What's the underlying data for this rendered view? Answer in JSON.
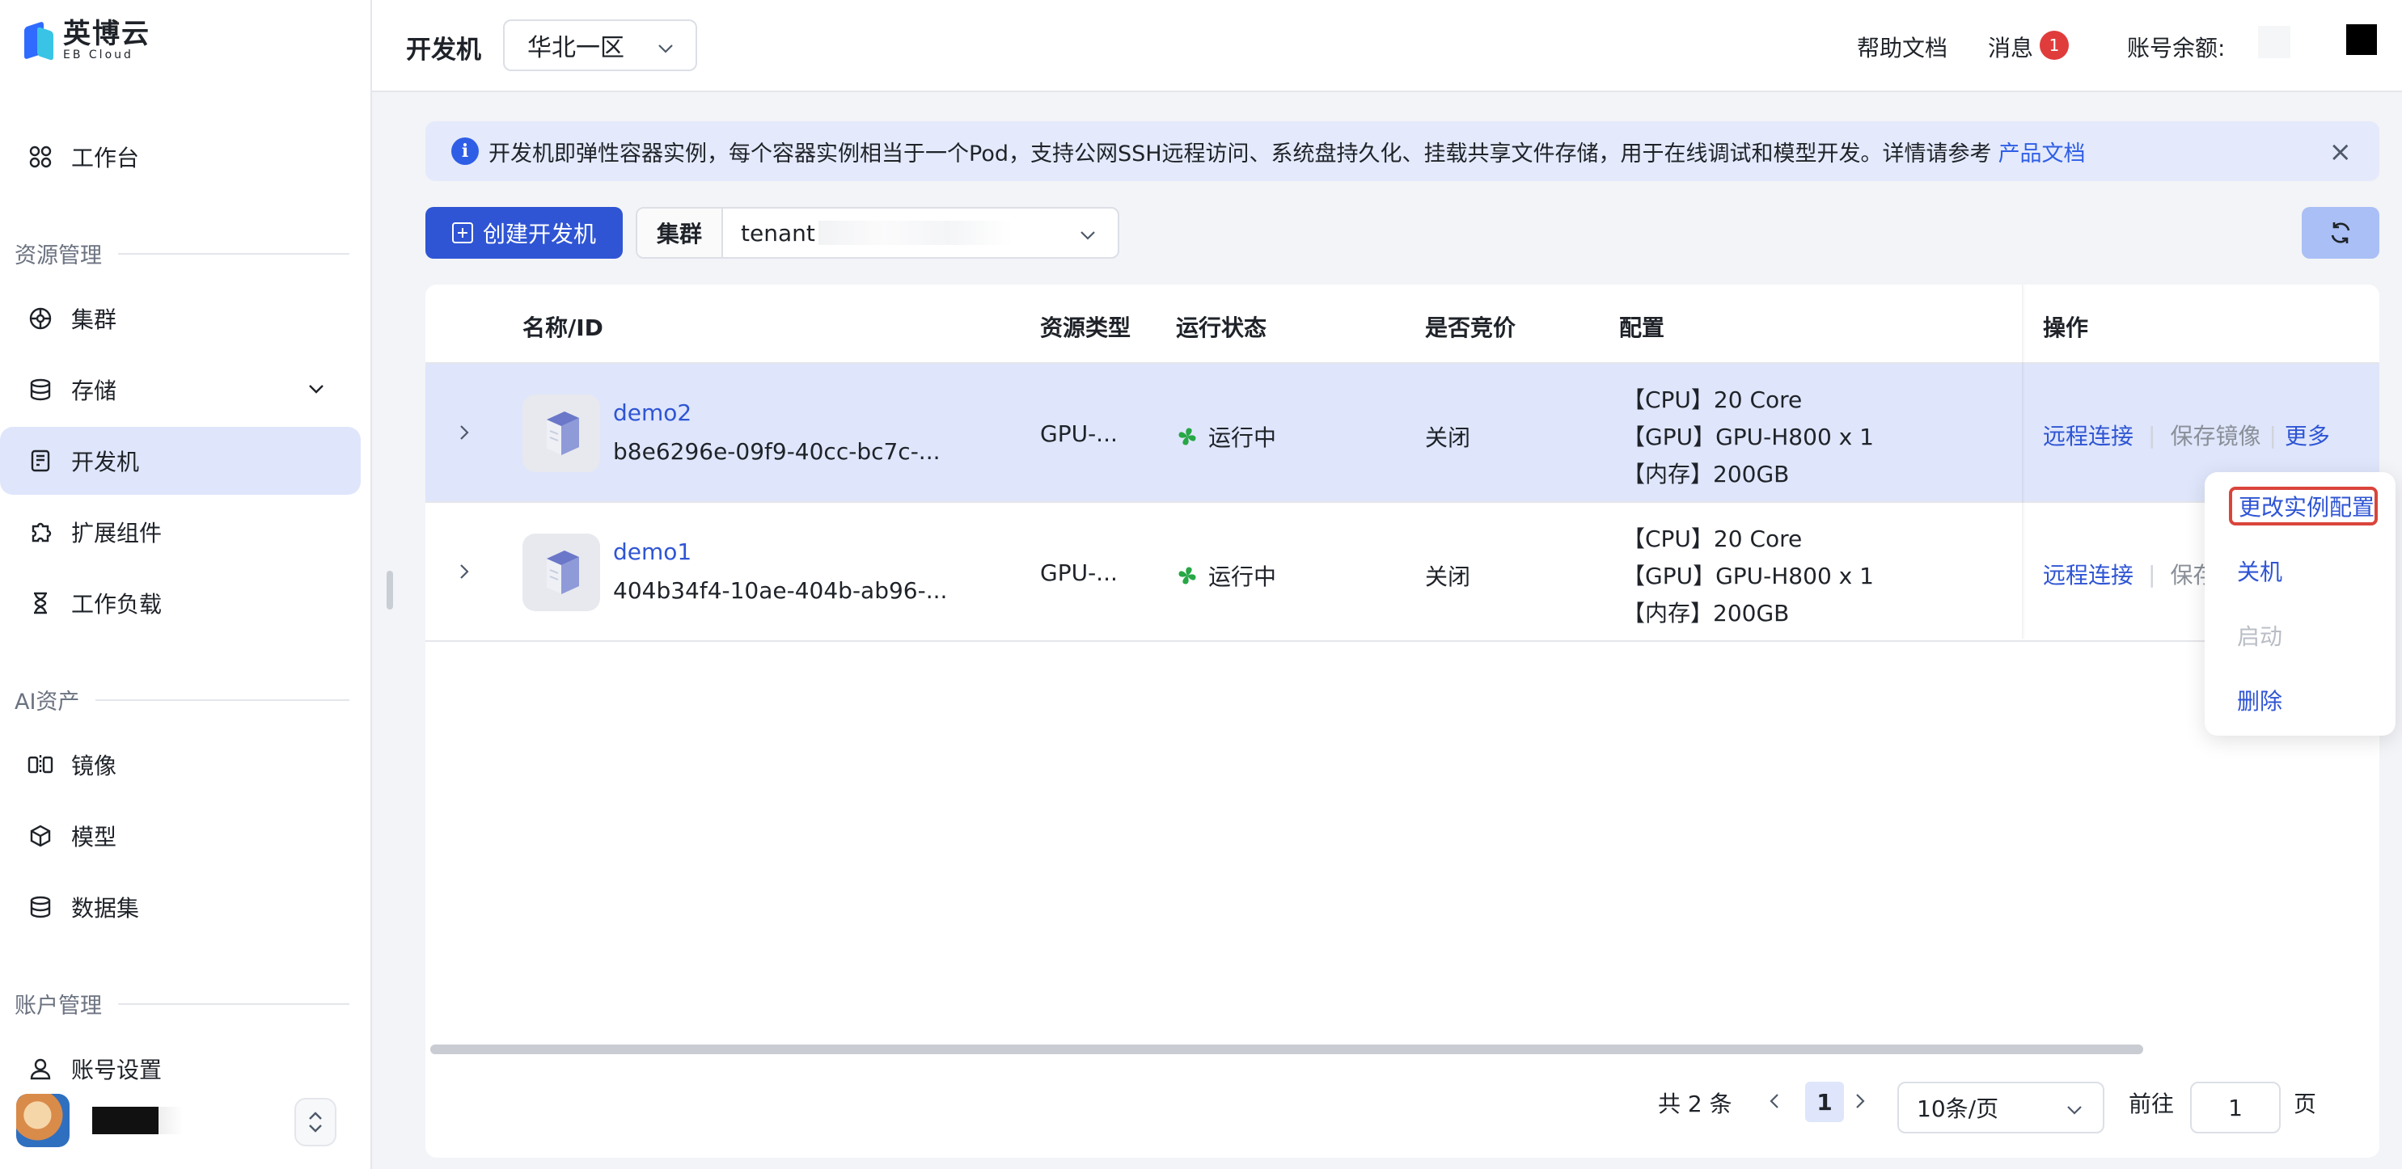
{
  "brand": {
    "name_cn": "英博云",
    "name_en": "EB Cloud"
  },
  "sidebar": {
    "items_top": [
      {
        "label": "工作台",
        "icon": "grid-icon"
      }
    ],
    "sections": [
      {
        "title": "资源管理",
        "items": [
          {
            "label": "集群",
            "icon": "cluster-icon"
          },
          {
            "label": "存储",
            "icon": "database-icon",
            "expandable": true
          },
          {
            "label": "开发机",
            "icon": "devbox-icon",
            "active": true
          },
          {
            "label": "扩展组件",
            "icon": "puzzle-icon"
          },
          {
            "label": "工作负载",
            "icon": "hourglass-icon"
          }
        ]
      },
      {
        "title": "AI资产",
        "items": [
          {
            "label": "镜像",
            "icon": "mirror-icon"
          },
          {
            "label": "模型",
            "icon": "cube-icon"
          },
          {
            "label": "数据集",
            "icon": "dataset-icon"
          }
        ]
      },
      {
        "title": "账户管理",
        "items": [
          {
            "label": "账号设置",
            "icon": "user-icon"
          }
        ]
      }
    ]
  },
  "header": {
    "title": "开发机",
    "region": "华北一区",
    "help": "帮助文档",
    "messages": "消息",
    "message_count": "1",
    "balance_label": "账号余额:"
  },
  "banner": {
    "text": "开发机即弹性容器实例，每个容器实例相当于一个Pod，支持公网SSH远程访问、系统盘持久化、挂载共享文件存储，用于在线调试和模型开发。详情请参考",
    "link": "产品文档",
    "close": "×"
  },
  "toolbar": {
    "create_label": "创建开发机",
    "cluster_label": "集群",
    "cluster_value": "tenant"
  },
  "table": {
    "columns": [
      "名称/ID",
      "资源类型",
      "运行状态",
      "是否竞价",
      "配置",
      "操作"
    ],
    "rows": [
      {
        "name": "demo2",
        "id": "b8e6296e-09f9-40cc-bc7c-...",
        "resource_type": "GPU-...",
        "status": "运行中",
        "spot": "关闭",
        "config": [
          "【CPU】20 Core",
          "【GPU】GPU-H800 x 1",
          "【内存】200GB"
        ],
        "ops": [
          "远程连接",
          "保存镜像",
          "更多"
        ]
      },
      {
        "name": "demo1",
        "id": "404b34f4-10ae-404b-ab96-...",
        "resource_type": "GPU-...",
        "status": "运行中",
        "spot": "关闭",
        "config": [
          "【CPU】20 Core",
          "【GPU】GPU-H800 x 1",
          "【内存】200GB"
        ],
        "ops": [
          "远程连接",
          "保存"
        ]
      }
    ]
  },
  "pagination": {
    "total": "共 2 条",
    "current": "1",
    "page_size": "10条/页",
    "goto_label": "前往",
    "goto_value": "1",
    "page_suffix": "页"
  },
  "more_menu": {
    "items": [
      {
        "label": "更改实例配置",
        "state": "highlighted"
      },
      {
        "label": "关机",
        "state": "enabled"
      },
      {
        "label": "启动",
        "state": "disabled"
      },
      {
        "label": "删除",
        "state": "enabled"
      }
    ]
  },
  "colors": {
    "primary": "#2f55d4",
    "active_bg": "#dfe6fb",
    "banner_bg": "#e4eafb",
    "status_green": "#27a745",
    "badge_red": "#e03c3c",
    "highlight_border": "#d9453b"
  }
}
